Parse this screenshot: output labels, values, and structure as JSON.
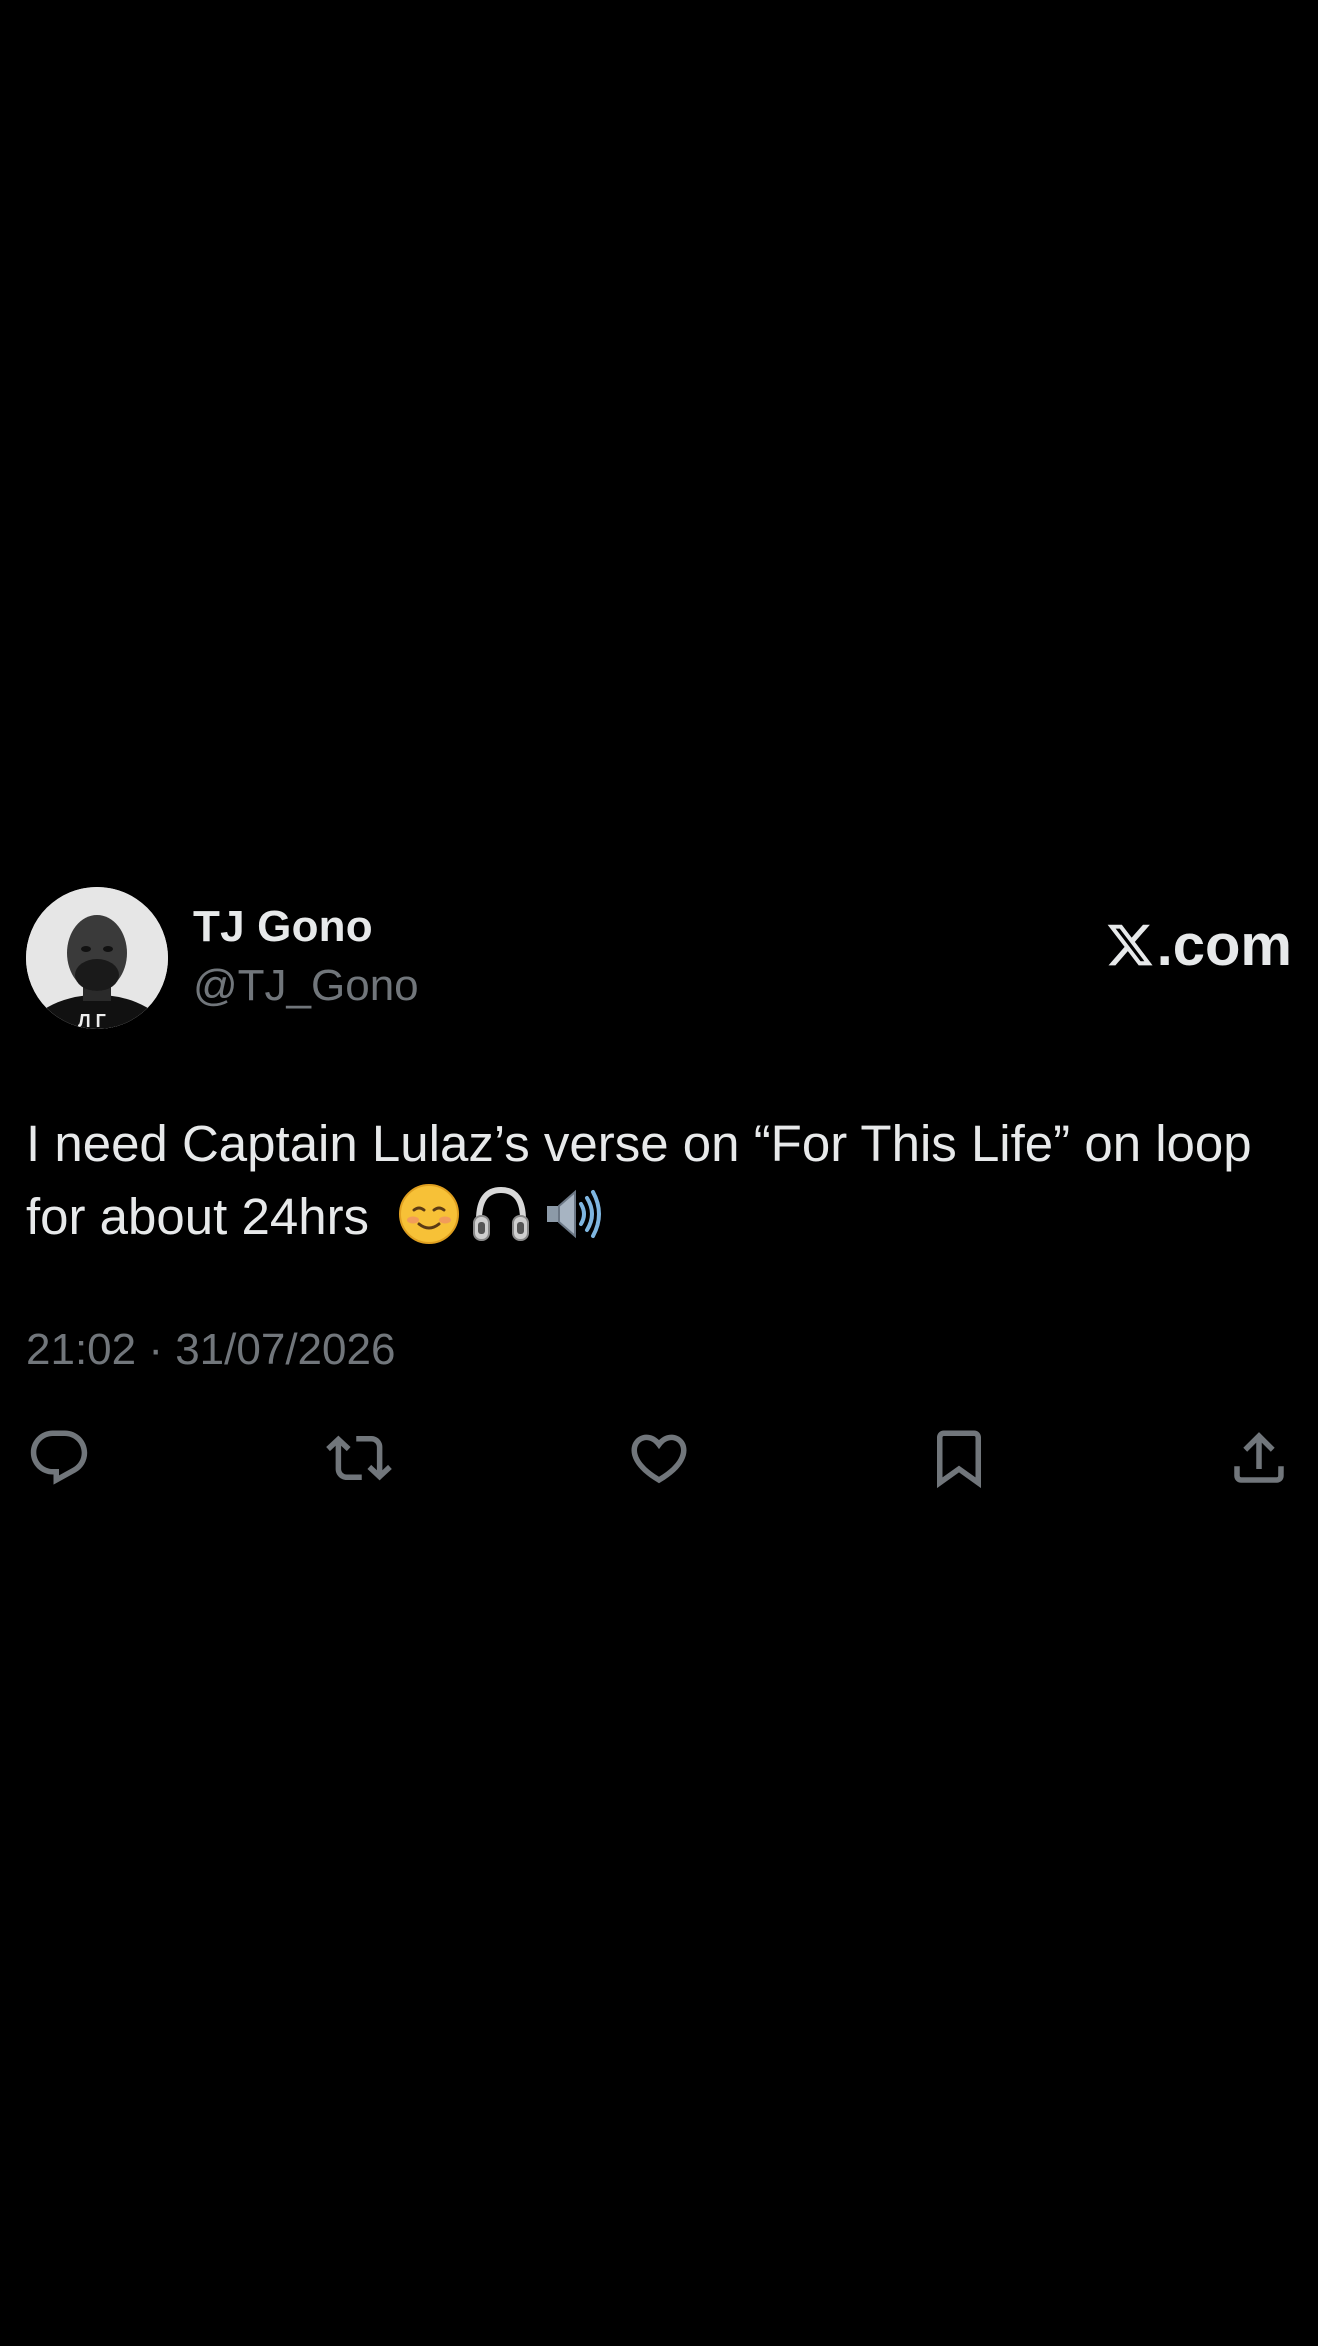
{
  "author": {
    "name": "TJ Gono",
    "handle": "@TJ_Gono"
  },
  "brand": {
    "label": ".com",
    "icon": "x-logo"
  },
  "tweet": {
    "text": "I need Captain Lulaz’s verse on “For This Life” on loop for about 24hrs",
    "emojis": [
      "smiling-face-icon",
      "headphones-icon",
      "speaker-icon"
    ],
    "timestamp": "21:02 · 31/07/2026"
  },
  "actions": [
    {
      "name": "reply",
      "icon": "reply-icon"
    },
    {
      "name": "retweet",
      "icon": "retweet-icon"
    },
    {
      "name": "like",
      "icon": "heart-icon"
    },
    {
      "name": "bookmark",
      "icon": "bookmark-icon"
    },
    {
      "name": "share",
      "icon": "share-icon"
    }
  ],
  "colors": {
    "background": "#000000",
    "primary_text": "#e7e9ea",
    "secondary_text": "#71767b"
  }
}
